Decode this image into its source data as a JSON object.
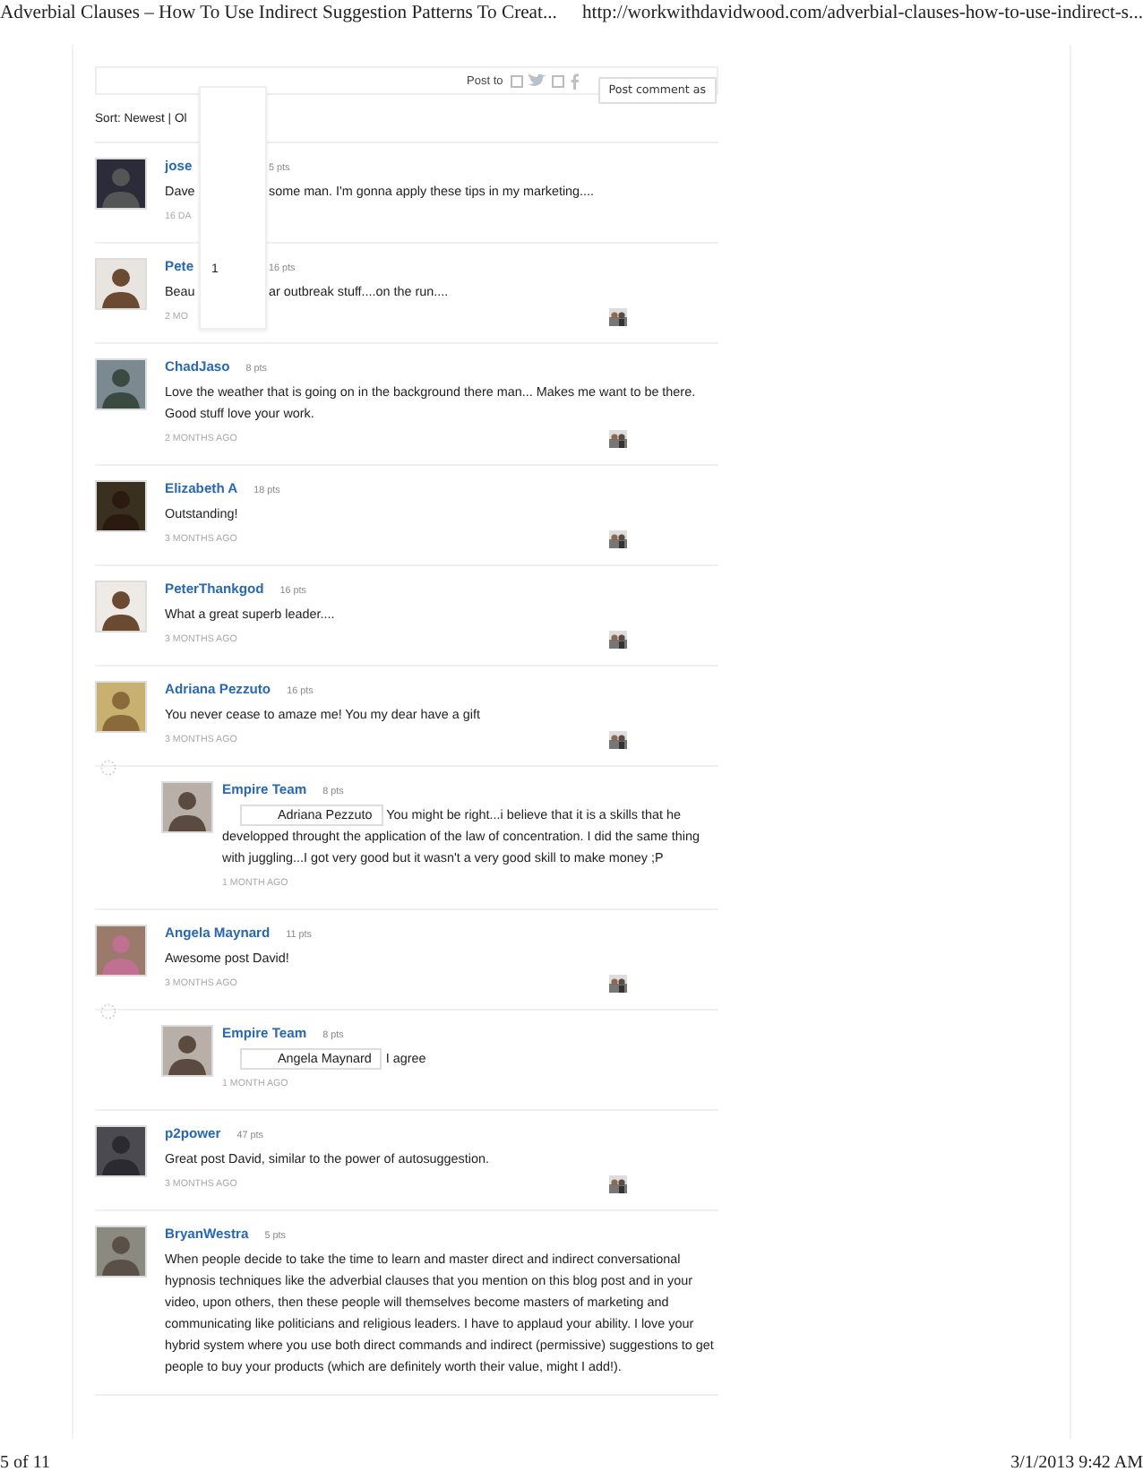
{
  "page_header": {
    "title": "Adverbial Clauses – How To Use Indirect Suggestion Patterns To Creat...",
    "url": "http://workwithdavidwood.com/adverbial-clauses-how-to-use-indirect-s..."
  },
  "comment_bar": {
    "post_to_label": "Post to",
    "post_button": "Post comment as"
  },
  "sort": {
    "label": "Sort: Newest | Ol"
  },
  "popup": {
    "text": "1"
  },
  "comments": [
    {
      "kind": "comment",
      "author": "jose",
      "points": "5 pts",
      "body": "Dave",
      "body_after": "some man. I'm gonna apply these tips in my marketing....",
      "time": "16 DA",
      "thumbnail": false
    },
    {
      "kind": "comment",
      "author": "Pete",
      "points": "16 pts",
      "body": "Beau",
      "body_after": "ar outbreak stuff....on the run....",
      "time": "2 MO",
      "thumbnail": true
    },
    {
      "kind": "comment",
      "author": "ChadJaso",
      "points": "8 pts",
      "body": "Love the weather that is going on in the background there man... Makes me want to be there.  Good stuff love your work.",
      "time": "2 MONTHS AGO",
      "thumbnail": true
    },
    {
      "kind": "comment",
      "author": "Elizabeth A",
      "points": "18 pts",
      "body": "Outstanding!",
      "time": "3 MONTHS AGO",
      "thumbnail": true
    },
    {
      "kind": "comment",
      "author": "PeterThankgod",
      "points": "16 pts",
      "body": "What a great superb leader....",
      "time": "3 MONTHS AGO",
      "thumbnail": true
    },
    {
      "kind": "comment",
      "author": "Adriana Pezzuto",
      "points": "16 pts",
      "body": "You never cease to amaze me! You my dear have a gift",
      "time": "3 MONTHS AGO",
      "thumbnail": true
    },
    {
      "kind": "reply",
      "author": "Empire Team",
      "points": "8 pts",
      "mention": "Adriana Pezzuto",
      "body": "You might be right...i believe that it is a skills that he developped throught the application of the law of concentration. I did the same thing with juggling...I got very good but it wasn't a very good skill to make money ;P",
      "time": "1 MONTH AGO",
      "thumbnail": false
    },
    {
      "kind": "comment",
      "author": "Angela Maynard",
      "points": "11 pts",
      "body": "Awesome post David!",
      "time": "3 MONTHS AGO",
      "thumbnail": true
    },
    {
      "kind": "reply",
      "author": "Empire Team",
      "points": "8 pts",
      "mention": "Angela Maynard",
      "body": "I agree",
      "time": "1 MONTH AGO",
      "thumbnail": false
    },
    {
      "kind": "comment",
      "author": "p2power",
      "points": "47 pts",
      "body": "Great post David, similar to the power of autosuggestion.",
      "time": "3 MONTHS AGO",
      "thumbnail": true
    },
    {
      "kind": "comment",
      "author": "BryanWestra",
      "points": "5 pts",
      "body": "When people decide to take the time to learn and master direct and indirect conversational hypnosis techniques like the adverbial clauses that you mention on this blog post and in your video, upon others, then these people will themselves become masters of marketing and communicating like politicians and religious leaders. I have to applaud your ability. I love your hybrid system where you use both direct commands and indirect (permissive) suggestions to get people to buy your products (which are definitely worth their value, might I add!).",
      "thumbnail": false
    }
  ],
  "page_footer": {
    "page": "5 of 11",
    "timestamp": "3/1/2013 9:42 AM"
  }
}
